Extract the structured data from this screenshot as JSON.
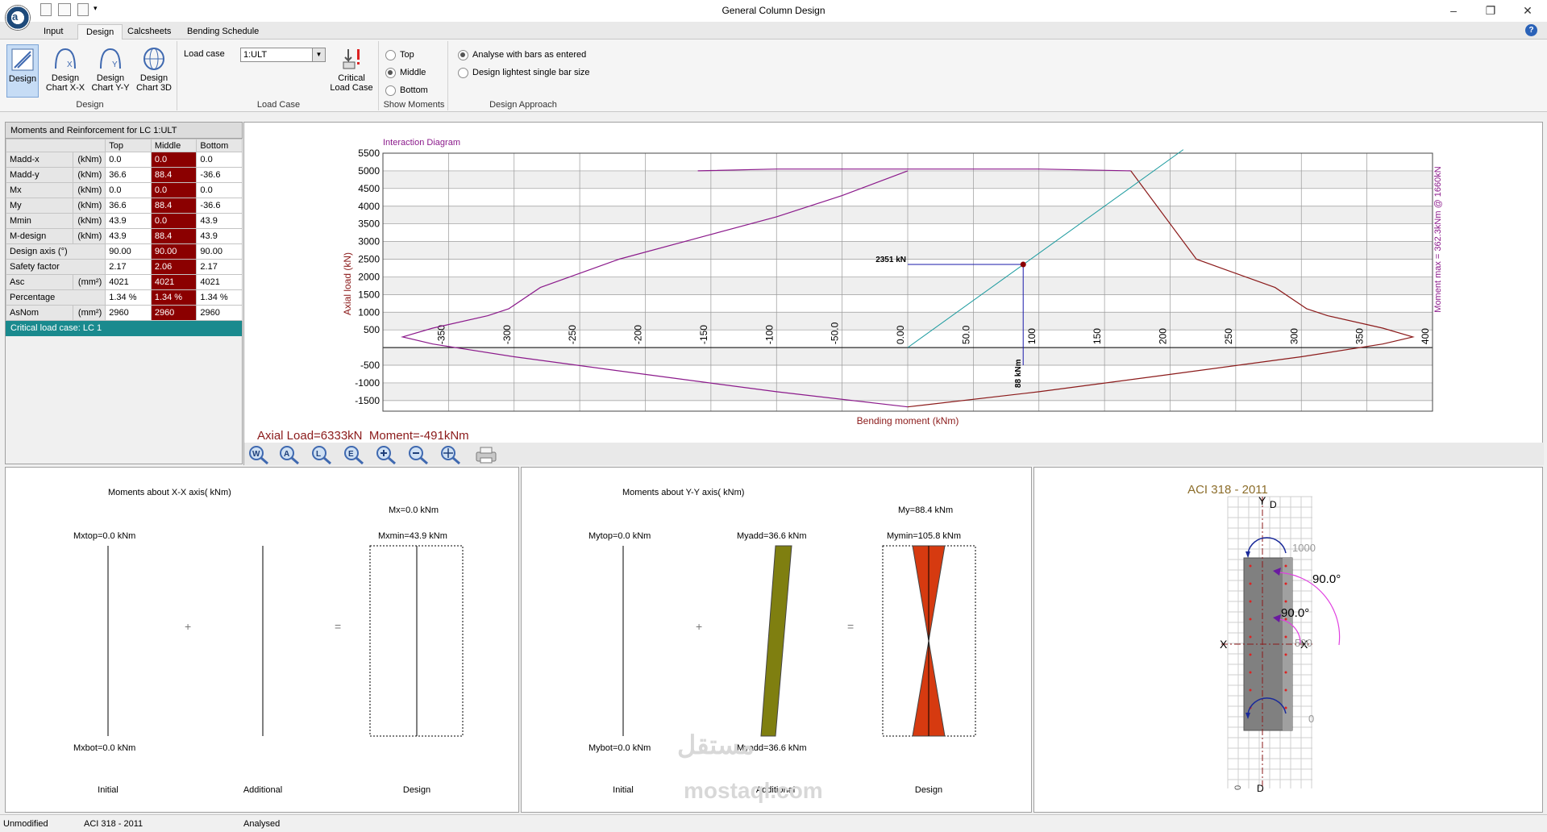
{
  "window": {
    "title": "General Column Design"
  },
  "tabs": [
    "Input",
    "Design",
    "Calcsheets",
    "Bending Schedule"
  ],
  "ribbon": {
    "design_group": {
      "label": "Design",
      "buttons": [
        "Design",
        "Design Chart X-X",
        "Design Chart Y-Y",
        "Design Chart 3D"
      ]
    },
    "load_case_group": {
      "label": "Load Case",
      "field_label": "Load case",
      "selected": "1:ULT",
      "critical_button": "Critical Load Case"
    },
    "show_moments_group": {
      "label": "Show Moments",
      "options": [
        "Top",
        "Middle",
        "Bottom"
      ],
      "selected": "Middle"
    },
    "design_approach_group": {
      "label": "Design Approach",
      "options": [
        "Analyse with bars as entered",
        "Design lightest single bar size"
      ],
      "selected": "Analyse with bars as entered"
    }
  },
  "moments_table": {
    "title": "Moments and Reinforcement for LC 1:ULT",
    "headers": [
      "Top",
      "Middle",
      "Bottom"
    ],
    "rows": [
      {
        "label": "Madd-x",
        "unit": "(kNm)",
        "top": "0.0",
        "middle": "0.0",
        "bottom": "0.0"
      },
      {
        "label": "Madd-y",
        "unit": "(kNm)",
        "top": "36.6",
        "middle": "88.4",
        "bottom": "-36.6"
      },
      {
        "label": "Mx",
        "unit": "(kNm)",
        "top": "0.0",
        "middle": "0.0",
        "bottom": "0.0"
      },
      {
        "label": "My",
        "unit": "(kNm)",
        "top": "36.6",
        "middle": "88.4",
        "bottom": "-36.6"
      },
      {
        "label": "Mmin",
        "unit": "(kNm)",
        "top": "43.9",
        "middle": "0.0",
        "bottom": "43.9"
      },
      {
        "label": "M-design",
        "unit": "(kNm)",
        "top": "43.9",
        "middle": "88.4",
        "bottom": "43.9"
      },
      {
        "label": "Design axis (°)",
        "unit": "",
        "top": "90.00",
        "middle": "90.00",
        "bottom": "90.00"
      },
      {
        "label": "Safety factor",
        "unit": "",
        "top": "2.17",
        "middle": "2.06",
        "bottom": "2.17"
      },
      {
        "label": "Asc",
        "unit": "(mm²)",
        "top": "4021",
        "middle": "4021",
        "bottom": "4021"
      },
      {
        "label": "Percentage",
        "unit": "",
        "top": "1.34 %",
        "middle": "1.34 %",
        "bottom": "1.34 %"
      },
      {
        "label": "AsNom",
        "unit": "(mm²)",
        "top": "2960",
        "middle": "2960",
        "bottom": "2960"
      }
    ],
    "critical": "Critical load case: LC 1"
  },
  "chart_data": {
    "type": "line",
    "title": "Interaction Diagram",
    "xlabel": "Bending moment (kNm)",
    "ylabel": "Axial load (kN)",
    "right_label": "Moment max = 362.3kNm @ 1660kN",
    "xlim": [
      -400,
      400
    ],
    "ylim": [
      -1800,
      5500
    ],
    "x_ticks": [
      "-350",
      "-300",
      "-250",
      "-200",
      "-150",
      "-100",
      "-50.0",
      "0.00",
      "50.0",
      "100",
      "150",
      "200",
      "250",
      "300",
      "350",
      "400"
    ],
    "y_ticks": [
      "5500",
      "5000",
      "4500",
      "4000",
      "3500",
      "3000",
      "2500",
      "2000",
      "1500",
      "1000",
      "500",
      "",
      "-500",
      "-1000",
      "-1500"
    ],
    "series": [
      {
        "color": "#8b1a8b",
        "points": [
          [
            0,
            -1680
          ],
          [
            -100,
            -1250
          ],
          [
            -200,
            -760
          ],
          [
            -300,
            -260
          ],
          [
            -362,
            100
          ],
          [
            -385,
            300
          ],
          [
            -362,
            550
          ],
          [
            -320,
            900
          ],
          [
            -304,
            1100
          ],
          [
            -280,
            1700
          ],
          [
            -220,
            2500
          ],
          [
            -160,
            3100
          ],
          [
            -100,
            3700
          ],
          [
            -50,
            4300
          ],
          [
            0,
            5000
          ]
        ]
      },
      {
        "color": "#8b1a8b",
        "points": [
          [
            -160,
            5000
          ],
          [
            -100,
            5050
          ],
          [
            0,
            5050
          ],
          [
            100,
            5050
          ],
          [
            170,
            5000
          ]
        ]
      },
      {
        "color": "#8b1a1a",
        "points": [
          [
            0,
            -1680
          ],
          [
            100,
            -1250
          ],
          [
            200,
            -760
          ],
          [
            300,
            -260
          ],
          [
            362,
            100
          ],
          [
            385,
            300
          ],
          [
            362,
            550
          ],
          [
            320,
            900
          ],
          [
            304,
            1100
          ],
          [
            280,
            1700
          ],
          [
            220,
            2500
          ],
          [
            170,
            5000
          ]
        ]
      }
    ],
    "design_point": {
      "x": 88,
      "y": 2351,
      "label_x": "88 kNm",
      "label_y": "2351 kN"
    },
    "load_line": {
      "from": [
        0,
        0
      ],
      "to": [
        210,
        5600
      ]
    },
    "readout": {
      "axial": "Axial Load=6333kN",
      "moment": "Moment=-491kNm"
    }
  },
  "bottom_panels": {
    "xx": {
      "title": "Moments about X-X axis( kNm)",
      "top_initial": "Mxtop=0.0 kNm",
      "bot_initial": "Mxbot=0.0 kNm",
      "design_top": "Mx=0.0 kNm",
      "design_min": "Mxmin=43.9 kNm",
      "labels": [
        "Initial",
        "Additional",
        "Design"
      ]
    },
    "yy": {
      "title": "Moments about Y-Y axis( kNm)",
      "top_initial": "Mytop=0.0 kNm",
      "bot_initial": "Mybot=0.0 kNm",
      "add_top": "Myadd=36.6 kNm",
      "add_bot": "Myadd=36.6 kNm",
      "design_top": "My=88.4 kNm",
      "design_min": "Mymin=105.8 kNm",
      "labels": [
        "Initial",
        "Additional",
        "Design"
      ]
    },
    "section": {
      "code": "ACI 318 - 2011",
      "dim_1000": "1000",
      "dim_500": "500",
      "dim_0": "0",
      "angle_outer": "90.0°",
      "angle_inner": "90.0°"
    }
  },
  "status": {
    "state": "Unmodified",
    "code": "ACI 318 - 2011",
    "result": "Analysed"
  },
  "watermark": {
    "arabic": "مستقل",
    "latin": "mostaql.com"
  }
}
